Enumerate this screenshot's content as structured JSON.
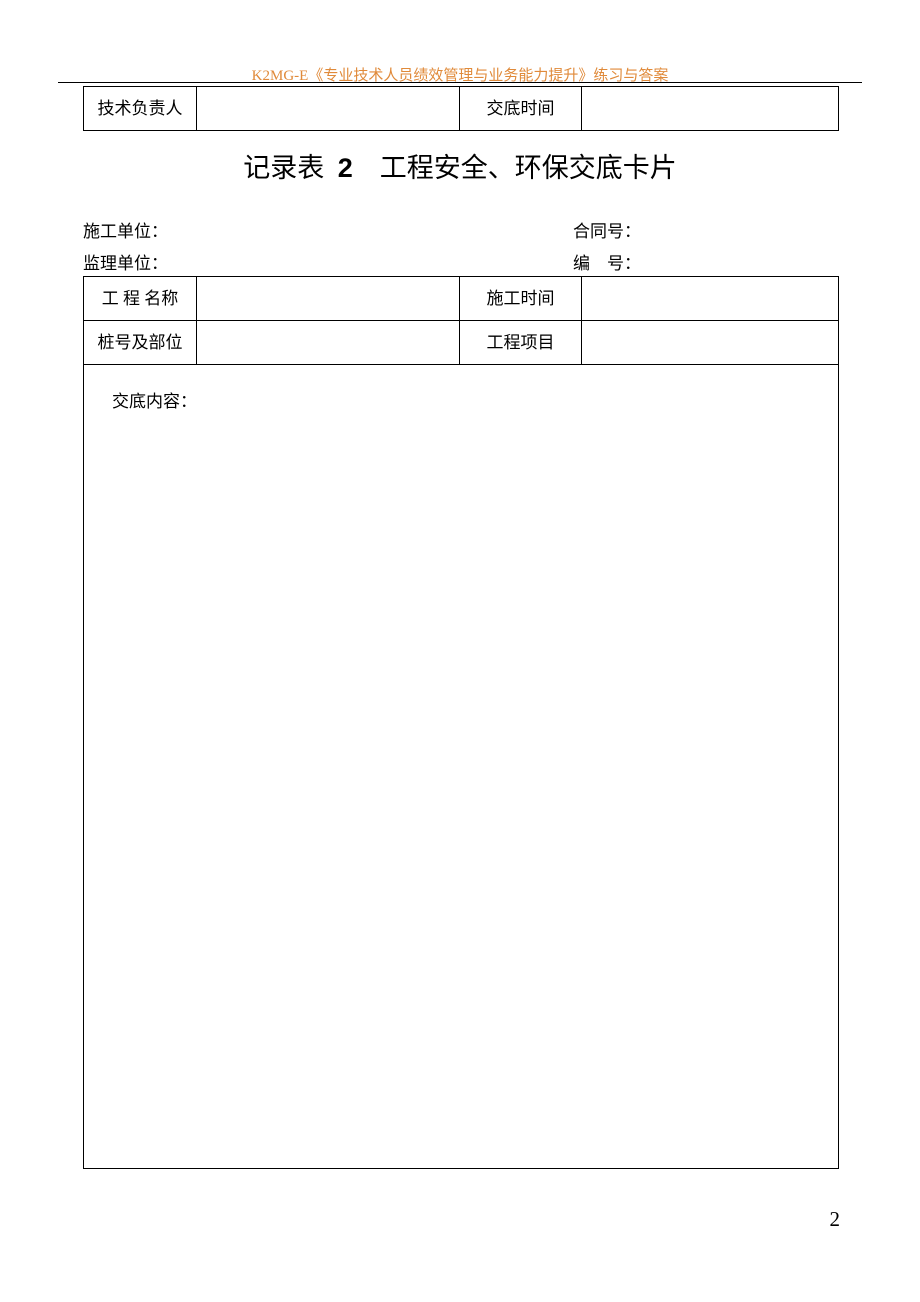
{
  "header": "K2MG-E《专业技术人员绩效管理与业务能力提升》练习与答案",
  "topTable": {
    "cell1": "技术负责人",
    "cell3": "交底时间"
  },
  "title": {
    "prefix": "记录表",
    "num": "2",
    "suffix": "工程安全、环保交底卡片"
  },
  "meta": {
    "row1_left": "施工单位：",
    "row1_right": "合同号：",
    "row2_left": "监理单位：",
    "row2_right": "编 号："
  },
  "mainTable": {
    "r1c1": "工 程 名称",
    "r1c3": "施工时间",
    "r2c1": "桩号及部位",
    "r2c3": "工程项目",
    "content_label": "交底内容："
  },
  "pageNumber": "2"
}
